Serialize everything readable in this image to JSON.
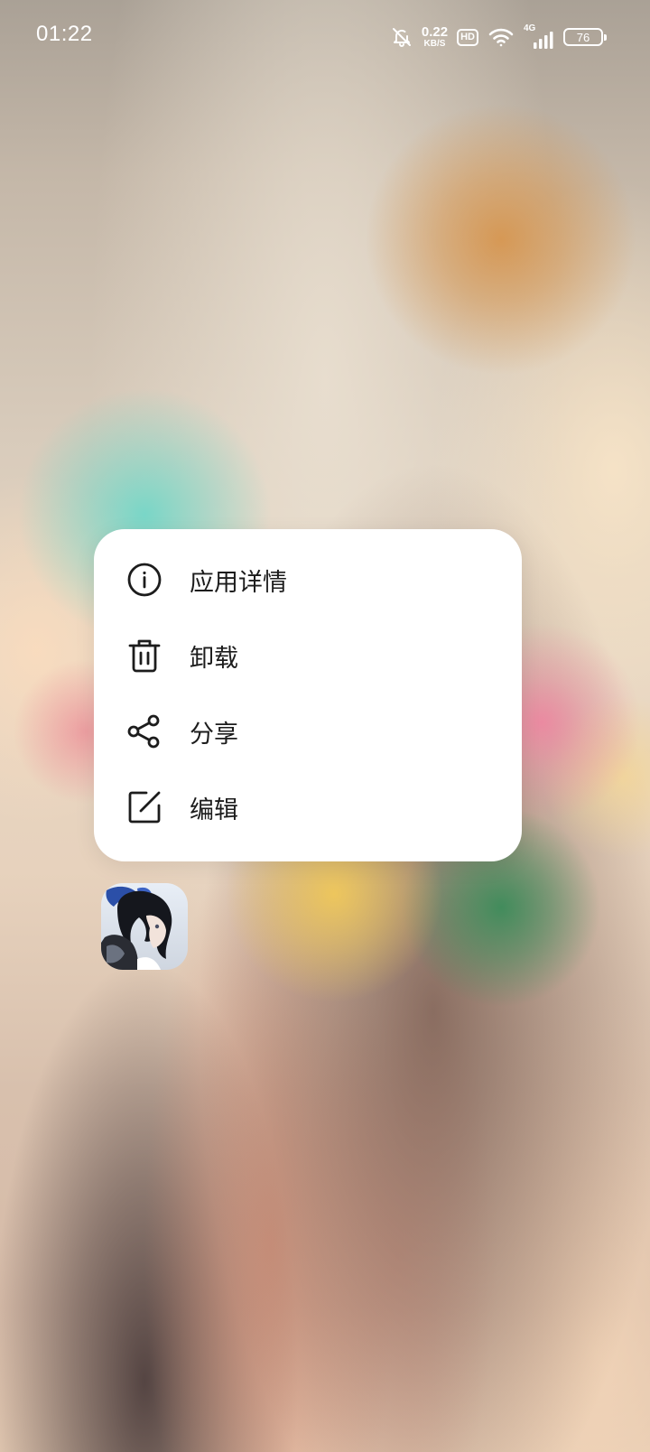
{
  "status_bar": {
    "time": "01:22",
    "net_speed_value": "0.22",
    "net_speed_unit": "KB/S",
    "hd_label": "HD",
    "network_type": "4G",
    "battery_level": "76",
    "icons": [
      "bell-off-icon",
      "wifi-icon",
      "signal-icon",
      "battery-icon"
    ]
  },
  "context_menu": {
    "items": [
      {
        "label": "应用详情",
        "icon": "info-icon"
      },
      {
        "label": "卸载",
        "icon": "trash-icon"
      },
      {
        "label": "分享",
        "icon": "share-icon"
      },
      {
        "label": "编辑",
        "icon": "edit-icon"
      }
    ]
  },
  "app_icon": {
    "icon": "app-icon"
  },
  "colors": {
    "menu_background": "#ffffff",
    "menu_text": "#1c1c1c",
    "status_text": "#ffffff"
  }
}
